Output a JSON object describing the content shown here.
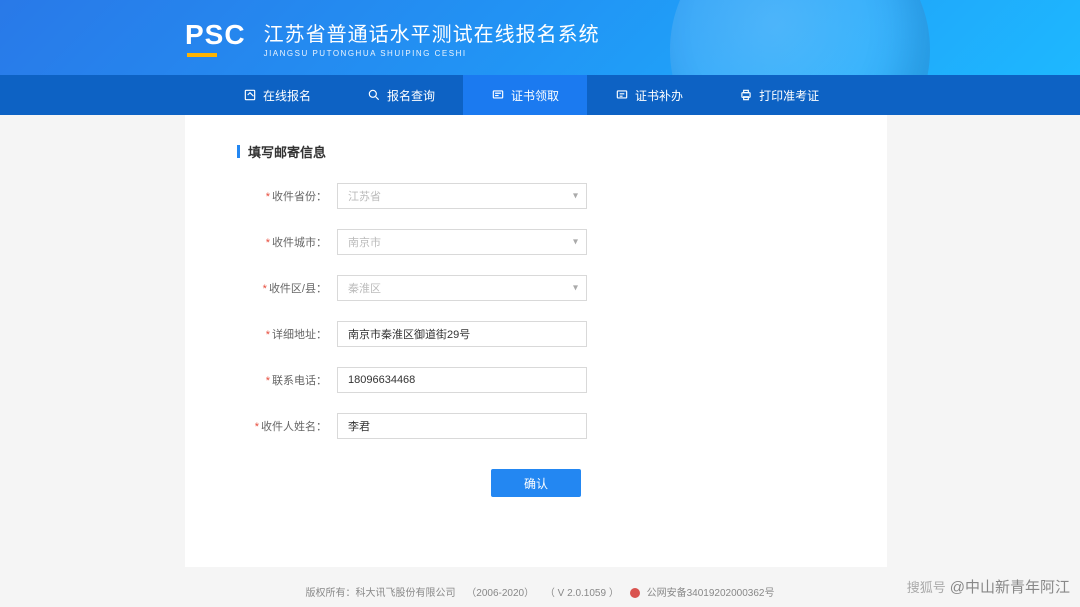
{
  "header": {
    "logo_text": "PSC",
    "title_cn": "江苏省普通话水平测试在线报名系统",
    "title_en": "JIANGSU PUTONGHUA SHUIPING CESHI"
  },
  "nav": {
    "items": [
      {
        "label": "在线报名",
        "icon": "edit-icon"
      },
      {
        "label": "报名查询",
        "icon": "search-icon"
      },
      {
        "label": "证书领取",
        "icon": "cert-icon",
        "active": true
      },
      {
        "label": "证书补办",
        "icon": "reissue-icon"
      },
      {
        "label": "打印准考证",
        "icon": "print-icon"
      }
    ]
  },
  "form": {
    "section_title": "填写邮寄信息",
    "fields": {
      "province": {
        "label": "收件省份：",
        "value": "江苏省"
      },
      "city": {
        "label": "收件城市：",
        "value": "南京市"
      },
      "district": {
        "label": "收件区/县：",
        "value": "秦淮区"
      },
      "address": {
        "label": "详细地址：",
        "value": "南京市秦淮区御道街29号"
      },
      "phone": {
        "label": "联系电话：",
        "value": "18096634468"
      },
      "name": {
        "label": "收件人姓名：",
        "value": "李君"
      }
    },
    "submit": "确认"
  },
  "footer": {
    "copyright": "版权所有：科大讯飞股份有限公司",
    "years": "（2006-2020）",
    "version": "（ V 2.0.1059 ）",
    "beian": "公网安备34019202000362号"
  },
  "watermark": {
    "source": "搜狐号",
    "author": "@中山新青年阿江"
  }
}
